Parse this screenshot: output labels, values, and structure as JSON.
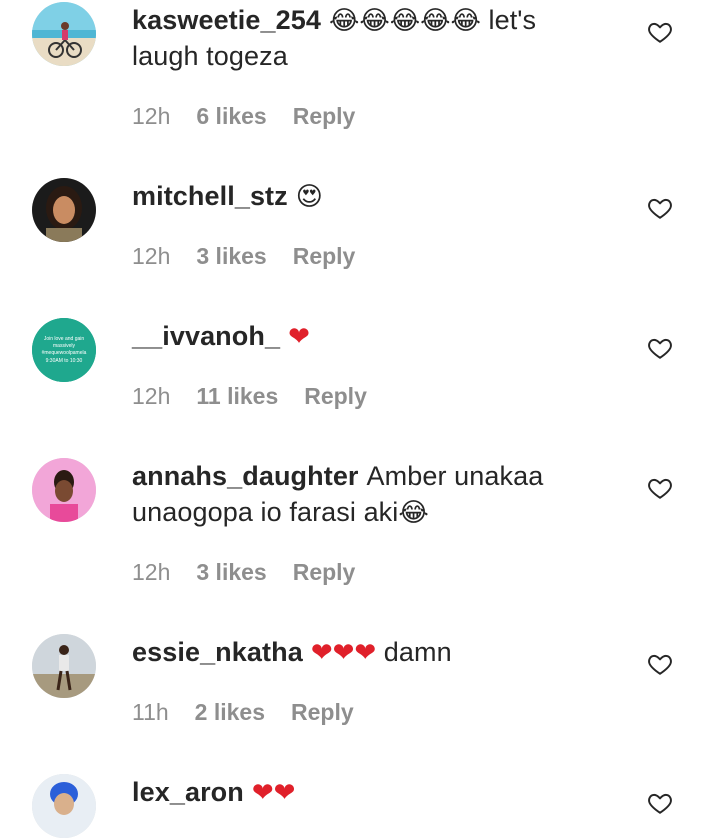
{
  "like_label": "Reply",
  "comments": [
    {
      "user": "kasweetie_254",
      "text_emoji": "😂😂😂😂😂",
      "text": " let's laugh togeza",
      "time": "12h",
      "likes": "6 likes",
      "reply": "Reply",
      "avatar_icon": "cyclist-beach-avatar"
    },
    {
      "user": "mitchell_stz",
      "text_emoji": "😍",
      "text": "",
      "time": "12h",
      "likes": "3 likes",
      "reply": "Reply",
      "avatar_icon": "woman-portrait-avatar"
    },
    {
      "user": "__ivvanoh_",
      "text_emoji": "❤",
      "text": "",
      "time": "12h",
      "likes": "11 likes",
      "reply": "Reply",
      "avatar_icon": "teal-flyer-avatar"
    },
    {
      "user": "annahs_daughter",
      "text": "Amber unakaa unaogopa io farasi aki",
      "text_emoji_after": "😂",
      "time": "12h",
      "likes": "3 likes",
      "reply": "Reply",
      "avatar_icon": "pink-portrait-avatar"
    },
    {
      "user": "essie_nkatha",
      "text_emoji": "❤❤❤",
      "text": " damn",
      "time": "11h",
      "likes": "2 likes",
      "reply": "Reply",
      "avatar_icon": "person-standing-avatar"
    },
    {
      "user": "lex_aron",
      "text_emoji": "❤❤",
      "text": "",
      "time": "",
      "likes": "",
      "reply": "",
      "avatar_icon": "blue-hair-avatar"
    }
  ],
  "avatar_flyer_text": [
    "Join love and gain",
    "massively",
    "#mequewoolpamela",
    "9:30AM to 10:30"
  ],
  "colors": {
    "text": "#262626",
    "meta": "#8e8e8e",
    "heart_emoji": "#e0202a"
  }
}
